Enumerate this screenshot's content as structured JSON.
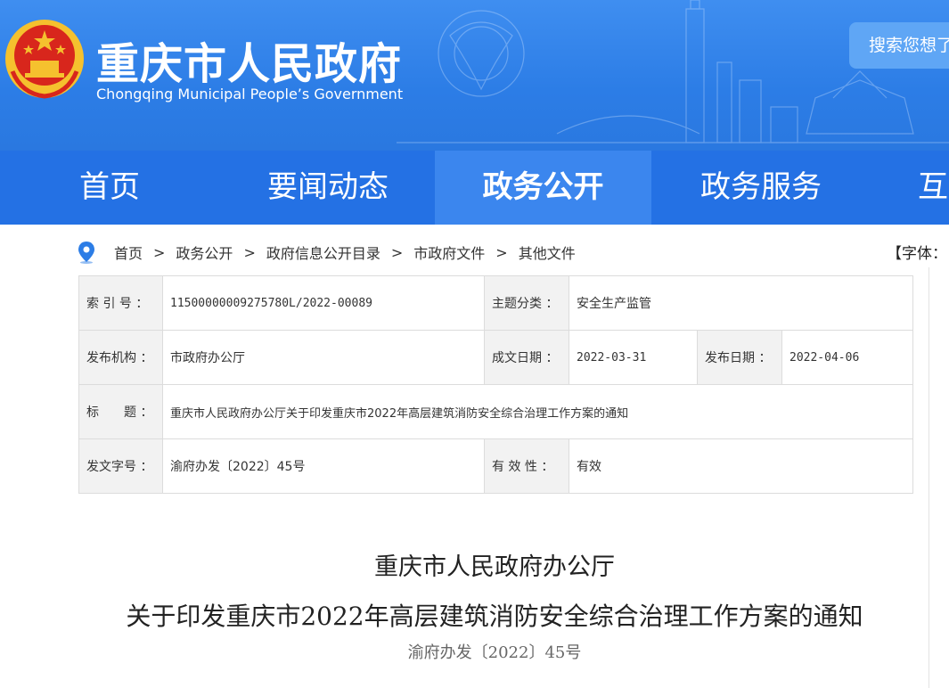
{
  "header": {
    "title": "重庆市人民政府",
    "subtitle": "Chongqing Municipal People’s Government",
    "search_placeholder": "搜索您想了"
  },
  "nav": {
    "items": [
      {
        "label": "首页"
      },
      {
        "label": "要闻动态"
      },
      {
        "label": "政务公开"
      },
      {
        "label": "政务服务"
      },
      {
        "label": "互"
      }
    ],
    "active": "政务公开"
  },
  "breadcrumb": {
    "items": [
      "首页",
      "政务公开",
      "政府信息公开目录",
      "市政府文件",
      "其他文件"
    ],
    "separator": ">"
  },
  "font_size_control": "【字体：",
  "info": {
    "index_label": "索 引 号 ：",
    "index_value": "11500000009275780L/2022-00089",
    "topic_label": "主题分类 ：",
    "topic_value": "安全生产监管",
    "issuer_label": "发布机构 ：",
    "issuer_value": "市政府办公厅",
    "created_label": "成文日期 ：",
    "created_value": "2022-03-31",
    "published_label": "发布日期 ：",
    "published_value": "2022-04-06",
    "title_label": "标　　题 ：",
    "title_value": "重庆市人民政府办公厅关于印发重庆市2022年高层建筑消防安全综合治理工作方案的通知",
    "docno_label": "发文字号 ：",
    "docno_value": "渝府办发〔2022〕45号",
    "validity_label": "有 效 性 ：",
    "validity_value": "有效"
  },
  "document": {
    "title_line1": "重庆市人民政府办公厅",
    "title_line2": "关于印发重庆市2022年高层建筑消防安全综合治理工作方案的通知",
    "number": "渝府办发〔2022〕45号"
  },
  "colors": {
    "header_blue": "#2c7de6",
    "nav_blue": "#2471e4",
    "nav_active": "#3b86ee",
    "emblem_red": "#d8261c",
    "emblem_gold": "#f5c12e"
  }
}
